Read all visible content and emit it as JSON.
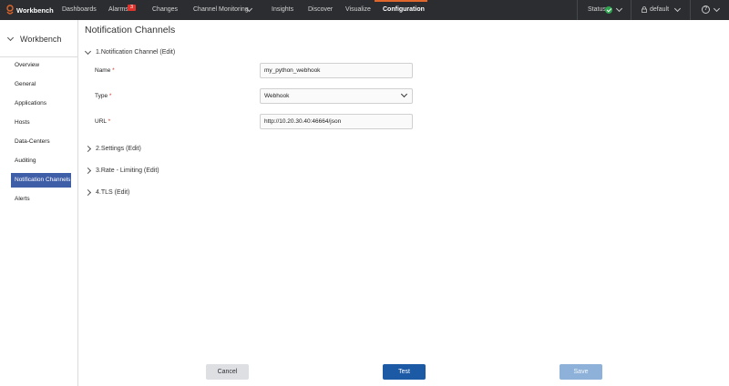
{
  "app": {
    "title": "Workbench"
  },
  "topnav": {
    "items": [
      {
        "label": "Dashboards"
      },
      {
        "label": "Alarms",
        "badge": "3"
      },
      {
        "label": "Changes"
      },
      {
        "label": "Channel Monitoring"
      },
      {
        "label": "Insights"
      },
      {
        "label": "Discover"
      },
      {
        "label": "Visualize"
      },
      {
        "label": "Configuration",
        "active": true
      }
    ],
    "status_label": "Status",
    "status_color": "#2ea44f",
    "profile_label": "default",
    "help_glyph": "?",
    "accent_color": "#e0662c"
  },
  "sidebar": {
    "title": "Workbench",
    "items": [
      {
        "label": "Overview"
      },
      {
        "label": "General"
      },
      {
        "label": "Applications"
      },
      {
        "label": "Hosts"
      },
      {
        "label": "Data-Centers"
      },
      {
        "label": "Auditing"
      },
      {
        "label": "Notification Channels",
        "active": true
      },
      {
        "label": "Alerts"
      }
    ],
    "active_color": "#3f5ea8"
  },
  "main": {
    "title": "Notification Channels",
    "sections": [
      {
        "label": "1.Notification Channel (Edit)",
        "expanded": true
      },
      {
        "label": "2.Settings (Edit)",
        "expanded": false
      },
      {
        "label": "3.Rate - Limiting (Edit)",
        "expanded": false
      },
      {
        "label": "4.TLS (Edit)",
        "expanded": false
      }
    ],
    "fields": {
      "name": {
        "label": "Name",
        "required": "*",
        "value": "my_python_webhook"
      },
      "type": {
        "label": "Type",
        "required": "*",
        "value": "Webhook"
      },
      "url": {
        "label": "URL",
        "required": "*",
        "value": "http://10.20.30.40:46664/json"
      }
    }
  },
  "buttons": {
    "cancel": "Cancel",
    "test": "Test",
    "save": "Save"
  }
}
